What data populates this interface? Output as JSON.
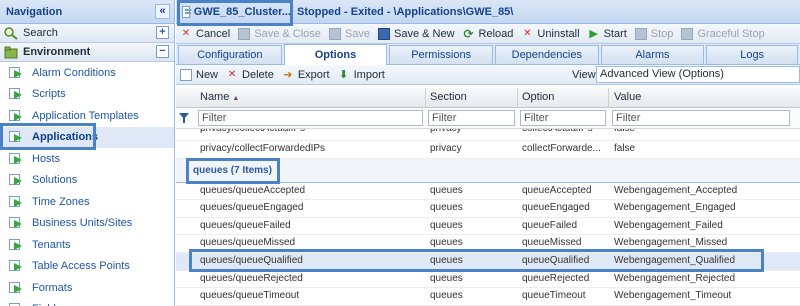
{
  "navigation": {
    "title": "Navigation",
    "collapse_icon": "chevron-double-left-icon",
    "search_label": "Search",
    "environment_label": "Environment",
    "items": [
      {
        "label": "Alarm Conditions"
      },
      {
        "label": "Scripts"
      },
      {
        "label": "Application Templates"
      },
      {
        "label": "Applications",
        "active": true
      },
      {
        "label": "Hosts"
      },
      {
        "label": "Solutions"
      },
      {
        "label": "Time Zones"
      },
      {
        "label": "Business Units/Sites"
      },
      {
        "label": "Tenants"
      },
      {
        "label": "Table Access Points"
      },
      {
        "label": "Formats"
      },
      {
        "label": "Fields"
      }
    ]
  },
  "object": {
    "name": "GWE_85_Cluster...",
    "status": "Stopped - Exited - \\Applications\\GWE_85\\"
  },
  "toolbar": {
    "cancel": "Cancel",
    "save_close": "Save & Close",
    "save": "Save",
    "save_new": "Save & New",
    "reload": "Reload",
    "uninstall": "Uninstall",
    "start": "Start",
    "stop": "Stop",
    "graceful_stop": "Graceful Stop"
  },
  "tabs": [
    {
      "label": "Configuration"
    },
    {
      "label": "Options",
      "active": true
    },
    {
      "label": "Permissions"
    },
    {
      "label": "Dependencies"
    },
    {
      "label": "Alarms"
    },
    {
      "label": "Logs"
    }
  ],
  "options_bar": {
    "new": "New",
    "delete": "Delete",
    "export": "Export",
    "import": "Import",
    "view_label": "View:",
    "view_value": "Advanced View (Options)"
  },
  "grid": {
    "columns": [
      "Name",
      "Section",
      "Option",
      "Value"
    ],
    "sort_indicator": "▲",
    "filter_placeholder": "Filter",
    "clipped_row": [
      "privacy/collectActualIPs",
      "privacy",
      "collectActualIPs",
      "false"
    ],
    "pre_rows": [
      [
        "privacy/collectForwardedIPs",
        "privacy",
        "collectForwarde...",
        "false"
      ]
    ],
    "group_label": "queues (7 Items)",
    "rows": [
      [
        "queues/queueAccepted",
        "queues",
        "queueAccepted",
        "Webengagement_Accepted"
      ],
      [
        "queues/queueEngaged",
        "queues",
        "queueEngaged",
        "Webengagement_Engaged"
      ],
      [
        "queues/queueFailed",
        "queues",
        "queueFailed",
        "Webengagement_Failed"
      ],
      [
        "queues/queueMissed",
        "queues",
        "queueMissed",
        "Webengagement_Missed"
      ],
      [
        "queues/queueQualified",
        "queues",
        "queueQualified",
        "Webengagement_Qualified"
      ],
      [
        "queues/queueRejected",
        "queues",
        "queueRejected",
        "Webengagement_Rejected"
      ],
      [
        "queues/queueTimeout",
        "queues",
        "queueTimeout",
        "Webengagement_Timeout"
      ]
    ]
  }
}
